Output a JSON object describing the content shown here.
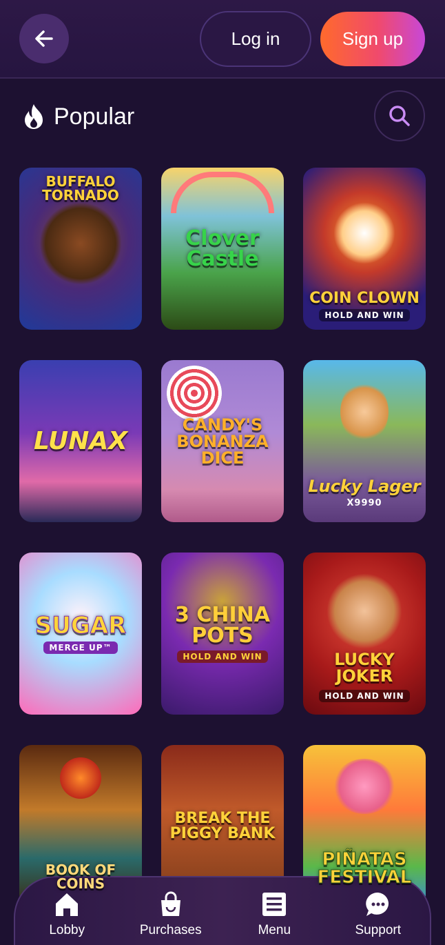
{
  "header": {
    "back_icon": "arrow-left-icon",
    "login_label": "Log in",
    "signup_label": "Sign up",
    "colors": {
      "signup_gradient": [
        "#ff6a2c",
        "#c748d8"
      ],
      "background": "#261540"
    }
  },
  "section": {
    "icon": "fire-icon",
    "title": "Popular",
    "search_icon": "search-icon"
  },
  "games": [
    {
      "title": "Buffalo Tornado",
      "sub": ""
    },
    {
      "title": "Clover Castle",
      "sub": ""
    },
    {
      "title": "Coin Clown",
      "sub": "HOLD AND WIN"
    },
    {
      "title": "LunaX",
      "sub": ""
    },
    {
      "title": "Candy's Bonanza Dice",
      "sub": ""
    },
    {
      "title": "Lucky Lager",
      "sub": "X9990"
    },
    {
      "title": "Sugar",
      "sub": "Merge Up™"
    },
    {
      "title": "3 China Pots",
      "sub": "HOLD AND WIN"
    },
    {
      "title": "Lucky Joker",
      "sub": "HOLD AND WIN"
    },
    {
      "title": "Book of Coins",
      "sub": ""
    },
    {
      "title": "Break the Piggy Bank",
      "sub": ""
    },
    {
      "title": "Piñatas Festival",
      "sub": ""
    }
  ],
  "nav": [
    {
      "label": "Lobby",
      "icon": "home-icon"
    },
    {
      "label": "Purchases",
      "icon": "shopping-bag-icon"
    },
    {
      "label": "Menu",
      "icon": "menu-icon"
    },
    {
      "label": "Support",
      "icon": "chat-icon"
    }
  ]
}
